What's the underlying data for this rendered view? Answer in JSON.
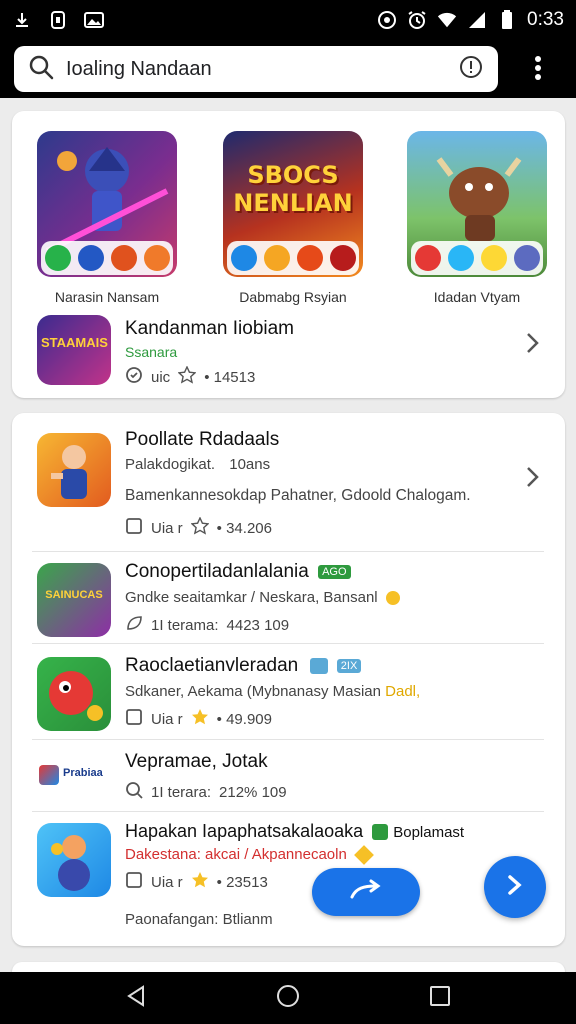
{
  "status_bar": {
    "time": "0:33"
  },
  "search": {
    "value": "Ioaling Nandaan"
  },
  "featured": {
    "items": [
      {
        "label": "Narasin Nansam"
      },
      {
        "label": "Dabmabg Rsyian",
        "art_text": "SBOCS NENLIAN"
      },
      {
        "label": "Idadan Vtyam"
      }
    ],
    "highlight": {
      "title": "Kandanman Iiobiam",
      "subtitle": "Ssanara",
      "tag": "uic",
      "rating_text": "• 14513",
      "icon_text": "STAAMAIS"
    }
  },
  "list": {
    "items": [
      {
        "title": "Poollate Rdadaals",
        "developer": "Palakdogikat.",
        "extra": "10ans",
        "description": "Bamenkannesokdap Pahatner, Gdoold Chalogam.",
        "meta_a": "Uia r",
        "rating_text": "• 34.206"
      },
      {
        "title": "Conopertiladanlalania",
        "tag": "AGO",
        "subtitle": "Gndke seaitamkar / Neskara, Bansanl",
        "meta_a": "1I terama:",
        "meta_b": "4423 109",
        "icon_text": "SAINUCAS"
      },
      {
        "title": "Raoclaetianvleradan",
        "tag": "2IX",
        "subtitle": "Sdkaner, Aekama (Mybnanasy Masian",
        "subtitle_highlight": "Dadl,",
        "meta_a": "Uia r",
        "rating_text": "• 49.909"
      },
      {
        "title": "Vepramae, Jotak",
        "meta_a": "1I terara:",
        "meta_b": "212% 109",
        "icon_text": "Prabiaa"
      },
      {
        "title": "Hapakan Iapaphatsakalaoaka",
        "tag": "Boplamast",
        "subtitle": "Dakestana: akcai / Akpannecaoln",
        "meta_a": "Uia r",
        "rating_text": "• 23513",
        "footer": "Paonafangan: Btlianm"
      }
    ]
  },
  "colors": {
    "accent": "#1a73e8",
    "green_text": "#2e9a3e",
    "red_text": "#d32f2f",
    "star": "#f6c026"
  }
}
